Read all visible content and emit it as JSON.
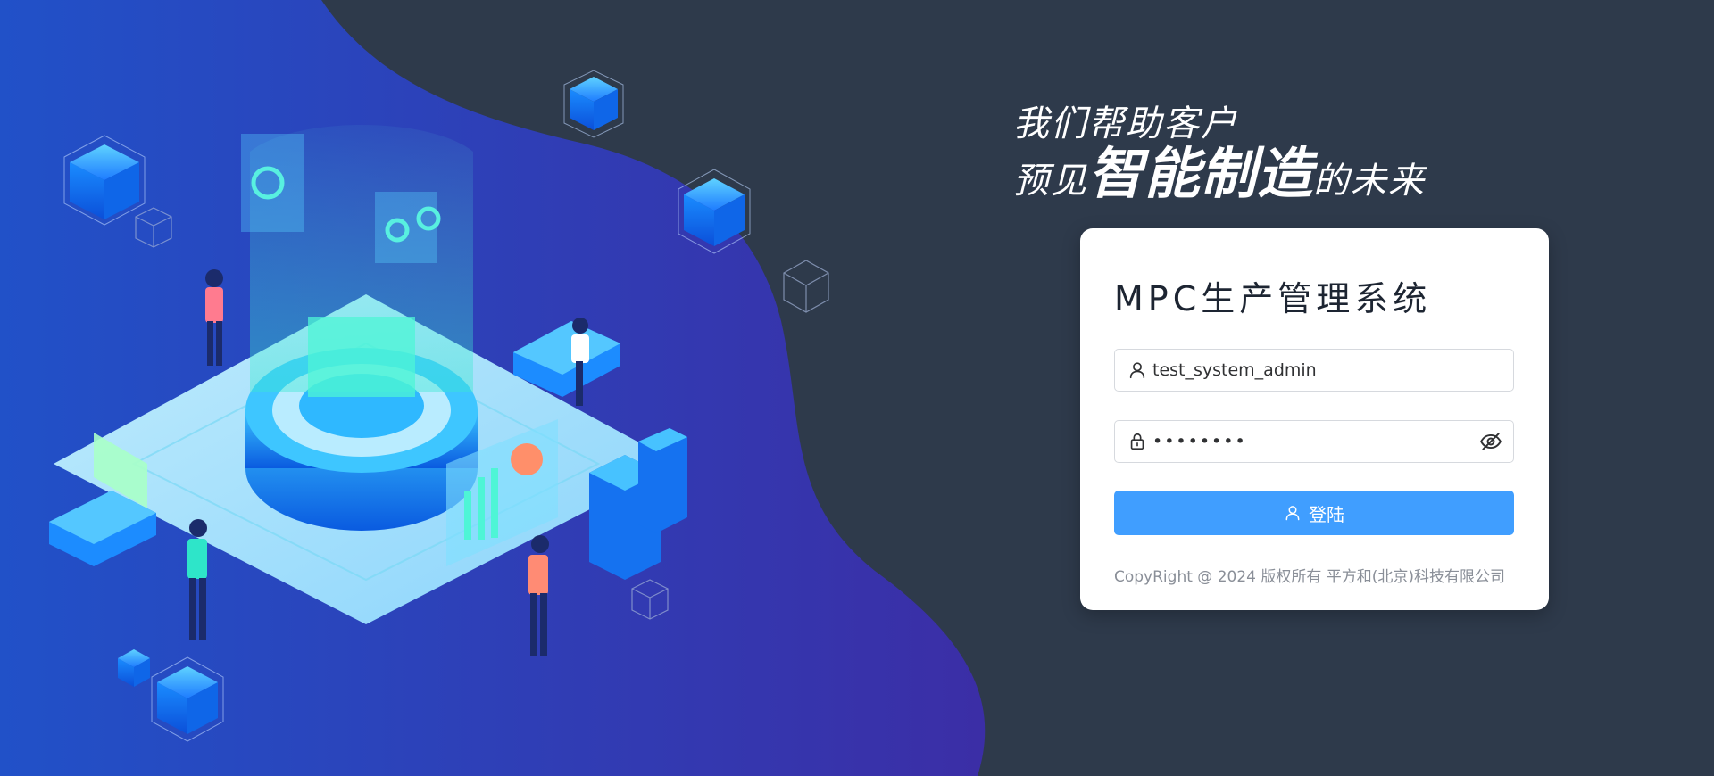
{
  "slogan": {
    "line1": "我们帮助客户",
    "line2_prefix": "预见",
    "line2_emphasis": "智能制造",
    "line2_suffix": "的未来"
  },
  "login": {
    "title": "MPC生产管理系统",
    "username": {
      "value": "test_system_admin",
      "icon": "user-icon"
    },
    "password": {
      "value": "••••••••",
      "icon": "lock-icon",
      "toggle_icon": "eye-off-icon"
    },
    "submit_label": "登陆",
    "submit_icon": "user-icon"
  },
  "footer": {
    "copyright": "CopyRight @ 2024 版权所有 平方和(北京)科技有限公司"
  },
  "colors": {
    "page_background": "#2e3a4b",
    "hero_gradient_start": "#1f4fc9",
    "hero_gradient_end": "#3a2fa6",
    "primary_button": "#409eff",
    "card_background": "#ffffff",
    "text_muted": "#8a8f98"
  }
}
